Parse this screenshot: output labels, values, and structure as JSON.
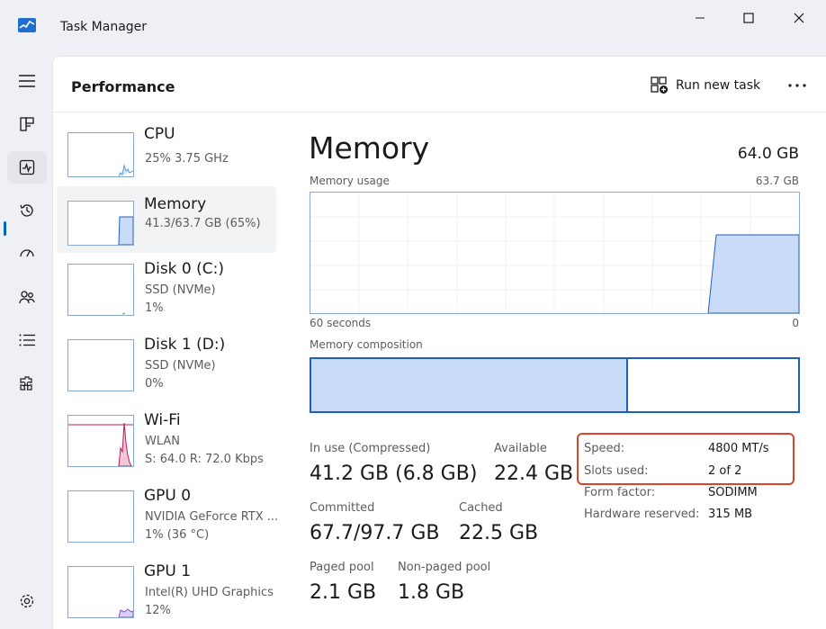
{
  "window": {
    "title": "Task Manager"
  },
  "header": {
    "page_title": "Performance",
    "run_new_task_label": "Run new task"
  },
  "nav": {
    "items": [
      "menu-icon",
      "processes-icon",
      "performance-icon",
      "app-history-icon",
      "startup-apps-icon",
      "users-icon",
      "details-icon",
      "services-icon"
    ],
    "settings": "settings-icon"
  },
  "devices": [
    {
      "name": "CPU",
      "lines": [
        "25%  3.75 GHz"
      ],
      "utilization": 25
    },
    {
      "name": "Memory",
      "lines": [
        "41.3/63.7 GB (65%)"
      ],
      "utilization": 65
    },
    {
      "name": "Disk 0 (C:)",
      "lines": [
        "SSD (NVMe)",
        "1%"
      ],
      "utilization": 1
    },
    {
      "name": "Disk 1 (D:)",
      "lines": [
        "SSD (NVMe)",
        "0%"
      ],
      "utilization": 0
    },
    {
      "name": "Wi-Fi",
      "lines": [
        "WLAN",
        "S: 64.0  R: 72.0 Kbps"
      ]
    },
    {
      "name": "GPU 0",
      "lines": [
        "NVIDIA GeForce RTX ...",
        "1% (36 °C)"
      ],
      "utilization": 1
    },
    {
      "name": "GPU 1",
      "lines": [
        "Intel(R) UHD Graphics",
        "12%"
      ],
      "utilization": 12
    }
  ],
  "memory": {
    "title": "Memory",
    "total": "64.0 GB",
    "usage_label": "Memory usage",
    "usage_max": "63.7 GB",
    "time_left": "60 seconds",
    "time_right": "0",
    "composition_label": "Memory composition",
    "composition_in_use_fraction": 0.65,
    "stats": {
      "in_use_label": "In use (Compressed)",
      "in_use_value": "41.2 GB (6.8 GB)",
      "available_label": "Available",
      "available_value": "22.4 GB",
      "committed_label": "Committed",
      "committed_value": "67.7/97.7 GB",
      "cached_label": "Cached",
      "cached_value": "22.5 GB",
      "paged_pool_label": "Paged pool",
      "paged_pool_value": "2.1 GB",
      "non_paged_pool_label": "Non-paged pool",
      "non_paged_pool_value": "1.8 GB"
    },
    "specs": [
      {
        "key": "Speed:",
        "value": "4800 MT/s"
      },
      {
        "key": "Slots used:",
        "value": "2 of 2"
      },
      {
        "key": "Form factor:",
        "value": "SODIMM"
      },
      {
        "key": "Hardware reserved:",
        "value": "315 MB"
      }
    ]
  },
  "colors": {
    "accent": "#0067c0",
    "memory_fill": "#c9dcf7",
    "memory_stroke": "#1f5fbf",
    "cpu_line": "#4aa3d8",
    "wifi_line": "#c2185b",
    "gpu_line": "#8a4fd6",
    "highlight": "#d9452b"
  }
}
